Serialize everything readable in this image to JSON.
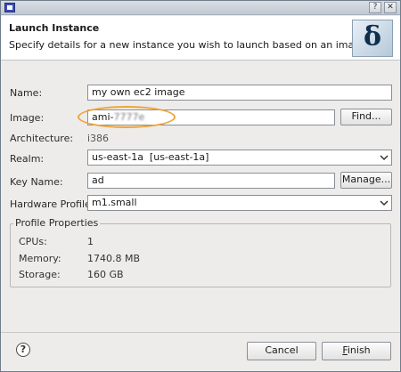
{
  "window": {
    "title": ""
  },
  "header": {
    "title": "Launch Instance",
    "description": "Specify details for a new instance you wish to launch based on an image",
    "image_icon": "delta-icon",
    "image_glyph": "δ"
  },
  "form": {
    "name_label": "Name:",
    "name_value": "my own ec2 image",
    "image_label": "Image:",
    "image_value_prefix": "ami-",
    "image_value_obscured": "7777e",
    "find_button": "Find...",
    "architecture_label": "Architecture:",
    "architecture_value": "i386",
    "realm_label": "Realm:",
    "realm_value": "us-east-1a  [us-east-1a]",
    "key_name_label": "Key Name:",
    "key_name_value": "ad",
    "manage_button": "Manage...",
    "hardware_profile_label": "Hardware Profile:",
    "hardware_profile_value": "m1.small"
  },
  "profile_properties": {
    "title": "Profile Properties",
    "rows": [
      {
        "label": "CPUs:",
        "value": "1"
      },
      {
        "label": "Memory:",
        "value": "1740.8 MB"
      },
      {
        "label": "Storage:",
        "value": "160 GB"
      }
    ]
  },
  "footer": {
    "help_icon": "?",
    "cancel_button": "Cancel",
    "finish_mnemonic": "F",
    "finish_rest": "inish"
  },
  "colors": {
    "highlight": "#f0a43a",
    "accent": "#3b4fb8"
  }
}
